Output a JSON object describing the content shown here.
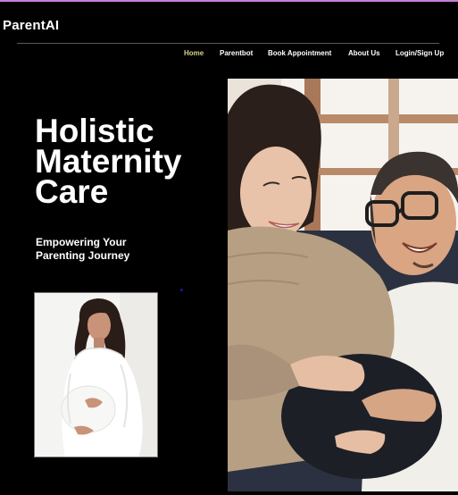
{
  "brand": {
    "name": "ParentAI"
  },
  "nav": {
    "items": [
      {
        "label": "Home",
        "active": true
      },
      {
        "label": "Parentbot",
        "active": false
      },
      {
        "label": "Book Appointment",
        "active": false
      },
      {
        "label": "About Us",
        "active": false
      },
      {
        "label": "Login/Sign Up",
        "active": false
      }
    ]
  },
  "hero": {
    "title_lines": [
      "Holistic",
      "Maternity",
      "Care"
    ],
    "subtitle_lines": [
      "Empowering Your",
      "Parenting Journey"
    ]
  },
  "images": {
    "small": {
      "icon": "pregnant-woman-photo"
    },
    "large": {
      "icon": "expecting-couple-photo"
    }
  },
  "colors": {
    "background": "#000000",
    "text": "#ffffff",
    "active_nav": "#d8d48a",
    "top_accent": "#c77dd6"
  }
}
